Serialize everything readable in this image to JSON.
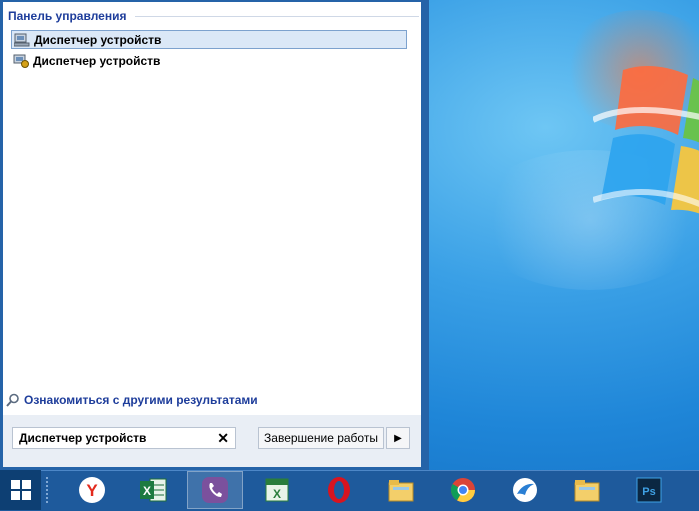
{
  "start_menu": {
    "group_title": "Панель управления",
    "results": [
      {
        "label": "Диспетчер устройств",
        "icon": "device-manager-icon",
        "selected": true
      },
      {
        "label": "Диспетчер устройств",
        "icon": "device-manager-icon",
        "selected": false
      }
    ],
    "more_results": "Ознакомиться с другими результатами",
    "search_value": "Диспетчер устройств",
    "clear_symbol": "✕",
    "shutdown_label": "Завершение работы",
    "shutdown_arrow": "▶"
  },
  "taskbar": {
    "items": [
      {
        "icon": "yandex-browser-icon"
      },
      {
        "icon": "excel-icon"
      },
      {
        "icon": "viber-icon",
        "active": true
      },
      {
        "icon": "excel-icon"
      },
      {
        "icon": "opera-icon"
      },
      {
        "icon": "explorer-folder-icon"
      },
      {
        "icon": "chrome-icon"
      },
      {
        "icon": "app-bird-icon"
      },
      {
        "icon": "explorer-folder-icon"
      },
      {
        "icon": "photoshop-icon"
      }
    ]
  },
  "colors": {
    "accent": "#1e3d9b",
    "taskbar": "#1e5a9c",
    "start_menu_frame": "#2563a8"
  }
}
